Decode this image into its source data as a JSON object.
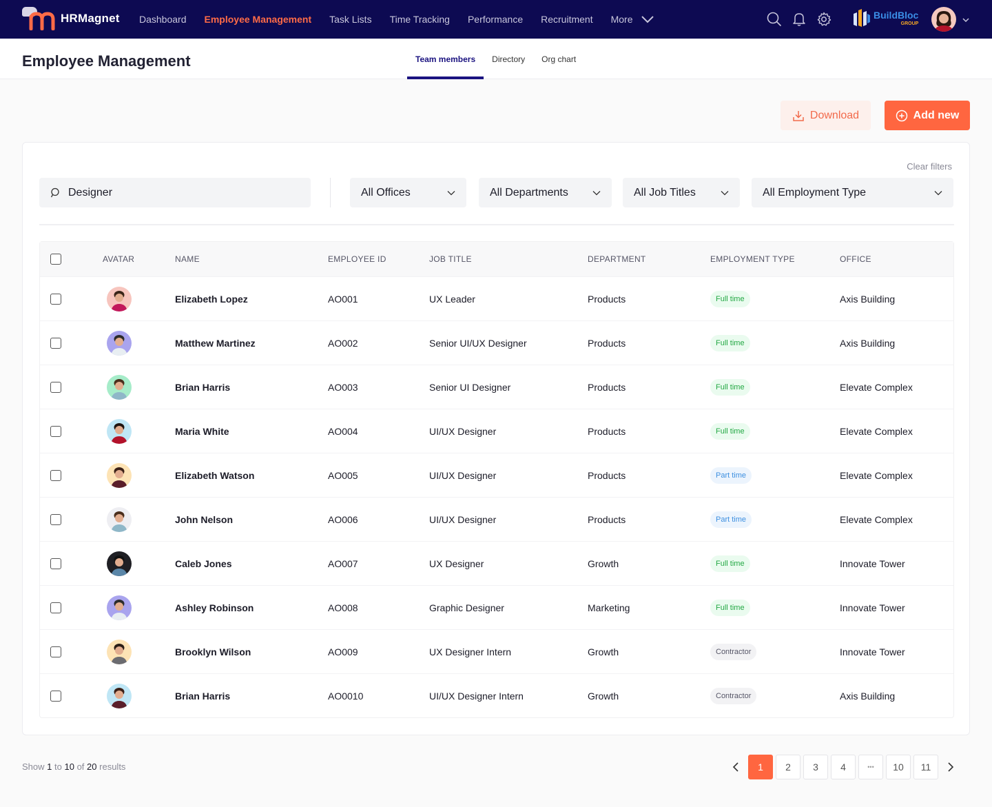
{
  "app": {
    "name": "HRMagnet",
    "brand_name": "BuildBloc",
    "brand_sub": "GROUP",
    "accent": "#ff6640",
    "nav_bg": "#0d0a52"
  },
  "nav": {
    "items": [
      {
        "label": "Dashboard",
        "active": false
      },
      {
        "label": "Employee Management",
        "active": true
      },
      {
        "label": "Task Lists",
        "active": false
      },
      {
        "label": "Time Tracking",
        "active": false
      },
      {
        "label": "Performance",
        "active": false
      },
      {
        "label": "Recruitment",
        "active": false
      }
    ],
    "more_label": "More"
  },
  "page": {
    "title": "Employee Management",
    "tabs": [
      {
        "label": "Team members",
        "active": true
      },
      {
        "label": "Directory",
        "active": false
      },
      {
        "label": "Org chart",
        "active": false
      }
    ]
  },
  "actions": {
    "download_label": "Download",
    "add_label": "Add new"
  },
  "filters": {
    "clear_label": "Clear filters",
    "search_value": "Designer",
    "offices": "All Offices",
    "departments": "All Departments",
    "job_titles": "All Job Titles",
    "employment_type": "All Employment Type"
  },
  "table": {
    "headers": {
      "avatar": "AVATAR",
      "name": "NAME",
      "employee_id": "EMPLOYEE ID",
      "job_title": "JOB TITLE",
      "department": "DEPARTMENT",
      "employment_type": "EMPLOYMENT TYPE",
      "office": "OFFICE"
    },
    "rows": [
      {
        "name": "Elizabeth Lopez",
        "id": "AO001",
        "job": "UX Leader",
        "dept": "Products",
        "type": "Full time",
        "type_kind": "full",
        "office": "Axis Building",
        "avatar_bg": "#f7c5be",
        "shirt": "#c2185b",
        "hair": "#3a2418"
      },
      {
        "name": "Matthew Martinez",
        "id": "AO002",
        "job": "Senior UI/UX Designer",
        "dept": "Products",
        "type": "Full time",
        "type_kind": "full",
        "office": "Axis Building",
        "avatar_bg": "#a9a4ee",
        "shirt": "#e8eef2",
        "hair": "#2b2b2b"
      },
      {
        "name": "Brian Harris",
        "id": "AO003",
        "job": "Senior UI Designer",
        "dept": "Products",
        "type": "Full time",
        "type_kind": "full",
        "office": "Elevate Complex",
        "avatar_bg": "#a6ecc9",
        "shirt": "#8fb7c8",
        "hair": "#4a2e1c"
      },
      {
        "name": "Maria White",
        "id": "AO004",
        "job": "UI/UX Designer",
        "dept": "Products",
        "type": "Full time",
        "type_kind": "full",
        "office": "Elevate Complex",
        "avatar_bg": "#bfe6f5",
        "shirt": "#b3122a",
        "hair": "#1e1410"
      },
      {
        "name": "Elizabeth Watson",
        "id": "AO005",
        "job": "UI/UX Designer",
        "dept": "Products",
        "type": "Part time",
        "type_kind": "part",
        "office": "Elevate Complex",
        "avatar_bg": "#fde3b5",
        "shirt": "#5a1e2a",
        "hair": "#3a1f16"
      },
      {
        "name": "John Nelson",
        "id": "AO006",
        "job": "UI/UX Designer",
        "dept": "Products",
        "type": "Part time",
        "type_kind": "part",
        "office": "Elevate Complex",
        "avatar_bg": "#eeeef2",
        "shirt": "#8fb7c8",
        "hair": "#4a2e1c"
      },
      {
        "name": "Caleb Jones",
        "id": "AO007",
        "job": "UX Designer",
        "dept": "Growth",
        "type": "Full time",
        "type_kind": "full",
        "office": "Innovate Tower",
        "avatar_bg": "#1f1f24",
        "shirt": "#5a86a8",
        "hair": "#111"
      },
      {
        "name": "Ashley Robinson",
        "id": "AO008",
        "job": "Graphic Designer",
        "dept": "Marketing",
        "type": "Full time",
        "type_kind": "full",
        "office": "Innovate Tower",
        "avatar_bg": "#a9a4ee",
        "shirt": "#e8eef2",
        "hair": "#2b2b2b"
      },
      {
        "name": "Brooklyn Wilson",
        "id": "AO009",
        "job": "UX Designer Intern",
        "dept": "Growth",
        "type": "Contractor",
        "type_kind": "contract",
        "office": "Innovate Tower",
        "avatar_bg": "#fde3b5",
        "shirt": "#6b6b70",
        "hair": "#2b1e16"
      },
      {
        "name": "Brian Harris",
        "id": "AO0010",
        "job": "UI/UX Designer Intern",
        "dept": "Growth",
        "type": "Contractor",
        "type_kind": "contract",
        "office": "Axis Building",
        "avatar_bg": "#bfe6f5",
        "shirt": "#5a1e2a",
        "hair": "#3a1f16"
      }
    ]
  },
  "pagination": {
    "show_label": "Show",
    "from": "1",
    "to_label": "to",
    "to": "10",
    "of_label": "of",
    "total": "20",
    "results_label": "results",
    "pages": [
      "1",
      "2",
      "3",
      "4",
      "•••",
      "10",
      "11"
    ],
    "current": "1"
  }
}
